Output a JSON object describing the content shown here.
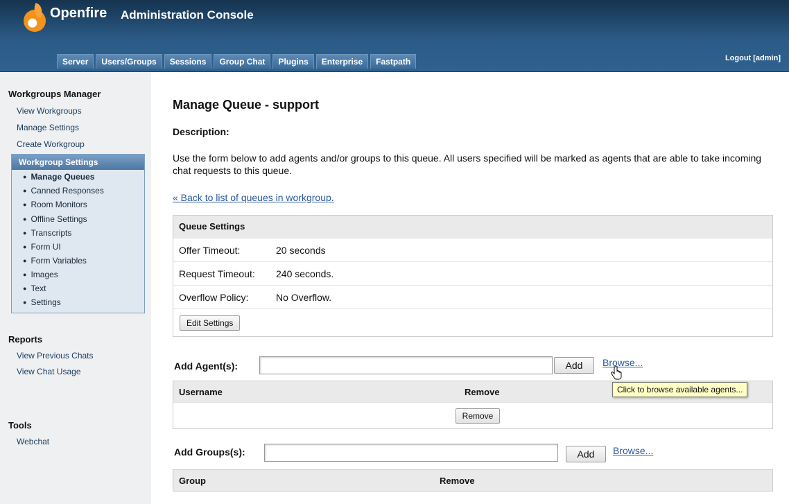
{
  "header": {
    "brand": "Openfire",
    "app_title": "Administration Console",
    "logout": "Logout [admin]",
    "tabs": [
      {
        "label": "Server"
      },
      {
        "label": "Users/Groups"
      },
      {
        "label": "Sessions"
      },
      {
        "label": "Group Chat"
      },
      {
        "label": "Plugins"
      },
      {
        "label": "Enterprise"
      },
      {
        "label": "Fastpath"
      }
    ]
  },
  "sidebar": {
    "workgroups_heading": "Workgroups Manager",
    "workgroups_links": [
      "View Workgroups",
      "Manage Settings",
      "Create Workgroup"
    ],
    "settings_box_title": "Workgroup Settings",
    "settings_items": [
      "Manage Queues",
      "Canned Responses",
      "Room Monitors",
      "Offline Settings",
      "Transcripts",
      "Form UI",
      "Form Variables",
      "Images",
      "Text",
      "Settings"
    ],
    "active_item": "Manage Queues",
    "reports_heading": "Reports",
    "reports_links": [
      "View Previous Chats",
      "View Chat Usage"
    ],
    "tools_heading": "Tools",
    "tools_links": [
      "Webchat"
    ]
  },
  "main": {
    "title": "Manage Queue - support",
    "description_label": "Description:",
    "description_text": "Use the form below to add agents and/or groups to this queue. All users specified will be marked as agents that are able to take incoming chat requests to this queue.",
    "back_link": "« Back to list of queues in workgroup.",
    "queue_settings": {
      "heading": "Queue Settings",
      "rows": [
        {
          "label": "Offer Timeout:",
          "value": "20 seconds"
        },
        {
          "label": "Request Timeout:",
          "value": "240 seconds."
        },
        {
          "label": "Overflow Policy:",
          "value": "No Overflow."
        }
      ],
      "edit_button": "Edit Settings"
    },
    "agents": {
      "label": "Add Agent(s):",
      "input_value": "",
      "add_button": "Add",
      "browse": "Browse...",
      "col_username": "Username",
      "col_remove": "Remove",
      "remove_button": "Remove",
      "tooltip": "Click to browse available agents..."
    },
    "groups": {
      "label": "Add Groups(s):",
      "input_value": "",
      "add_button": "Add",
      "browse": "Browse...",
      "col_group": "Group",
      "col_remove": "Remove"
    }
  }
}
